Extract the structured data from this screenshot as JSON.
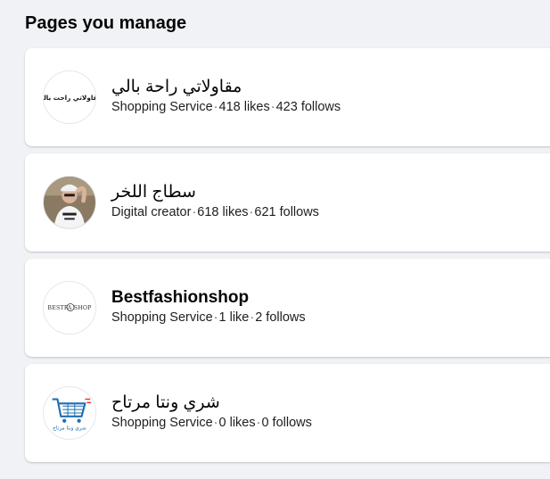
{
  "section": {
    "title": "Pages you manage"
  },
  "pages": [
    {
      "name": "مقاولاتي راحة بالي",
      "category": "Shopping Service",
      "likes": "418 likes",
      "follows": "423 follows",
      "avatar_text": "مقاولاتي راحت بالي",
      "avatar_icon": "text-logo-icon"
    },
    {
      "name": "سطاج اللخر",
      "category": "Digital creator",
      "likes": "618 likes",
      "follows": "621 follows",
      "avatar_icon": "person-photo-icon"
    },
    {
      "name": "Bestfashionshop",
      "category": "Shopping Service",
      "likes": "1 like",
      "follows": "2 follows",
      "avatar_text": "BESTFA SHOP",
      "avatar_icon": "hanger-logo-icon"
    },
    {
      "name": "شري ونتا مرتاح",
      "category": "Shopping Service",
      "likes": "0 likes",
      "follows": "0 follows",
      "avatar_text": "شري ونتا مرتاح",
      "avatar_icon": "shopping-cart-icon"
    }
  ],
  "separator": "·",
  "colors": {
    "background": "#f0f2f5",
    "card": "#ffffff",
    "text_primary": "#050505",
    "text_secondary": "#65676b"
  }
}
